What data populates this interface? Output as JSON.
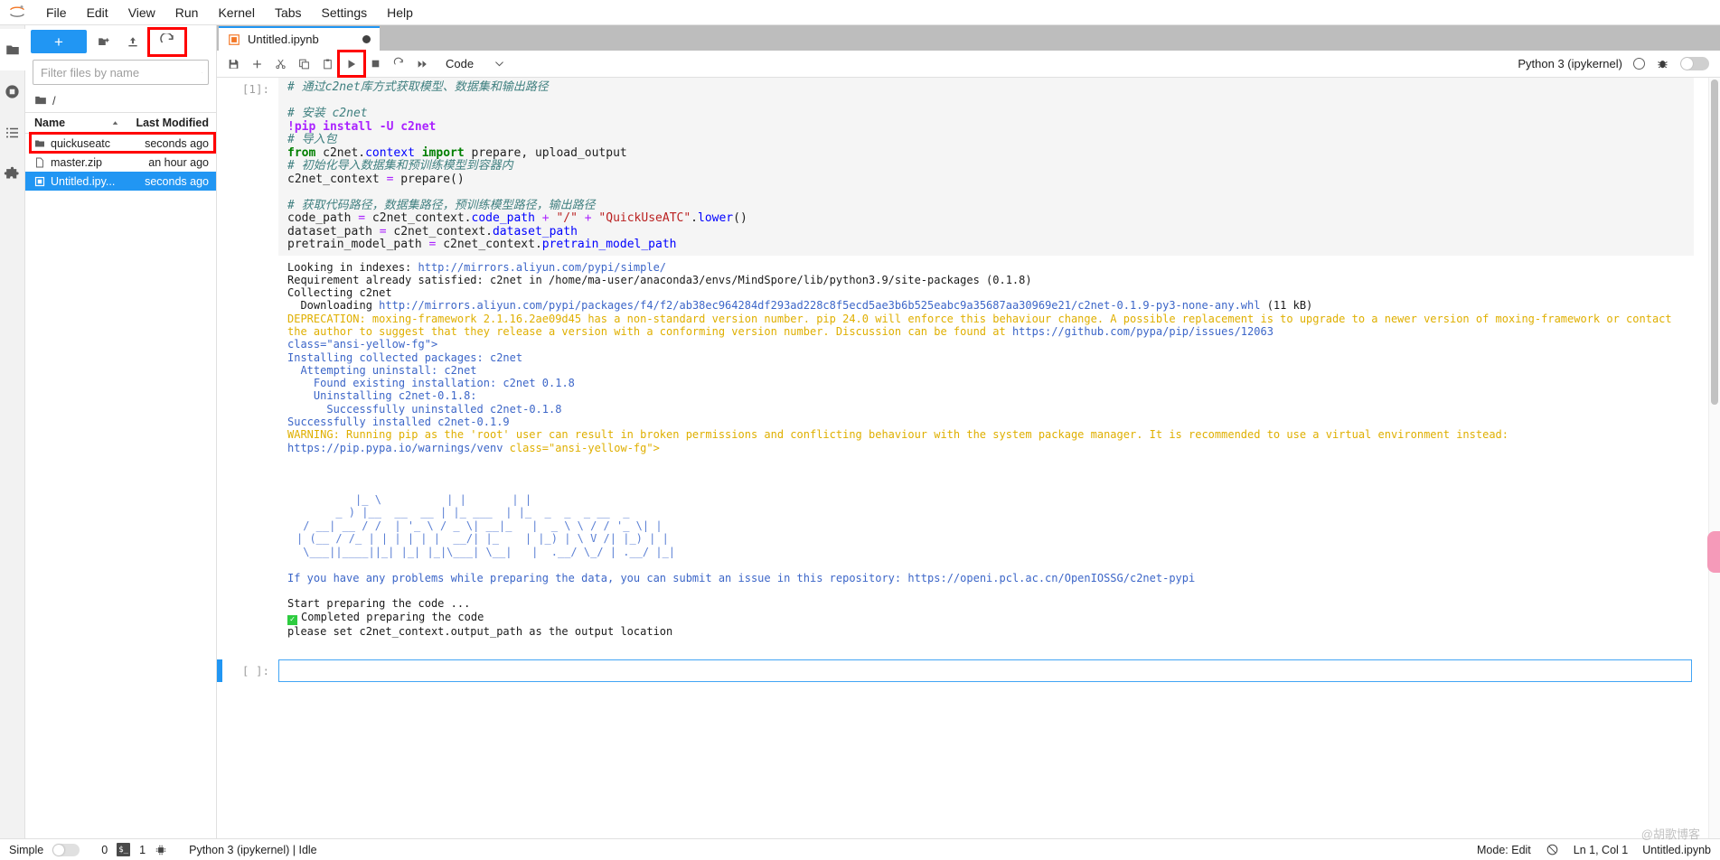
{
  "app": {
    "logo_icon": "jupyter-logo",
    "menus": [
      "File",
      "Edit",
      "View",
      "Run",
      "Kernel",
      "Tabs",
      "Settings",
      "Help"
    ]
  },
  "rail": {
    "items": [
      {
        "name": "file-browser",
        "icon": "folder-icon"
      },
      {
        "name": "running-terminals",
        "icon": "stop-circle-icon"
      },
      {
        "name": "table-of-contents",
        "icon": "list-icon"
      },
      {
        "name": "extension-manager",
        "icon": "puzzle-icon"
      }
    ]
  },
  "filebrowser": {
    "new_label": "+",
    "new_folder_icon": "new-folder-icon",
    "upload_icon": "upload-icon",
    "refresh_icon": "refresh-icon",
    "filter_placeholder": "Filter files by name",
    "search_icon": "search-icon",
    "breadcrumb_icon": "folder-icon",
    "breadcrumb": "/",
    "columns": {
      "name": "Name",
      "modified": "Last Modified"
    },
    "sort_icon": "sort-asc-icon",
    "rows": [
      {
        "name": "quickuseatc",
        "modified": "seconds ago",
        "type": "folder",
        "selected": false,
        "highlighted": true
      },
      {
        "name": "master.zip",
        "modified": "an hour ago",
        "type": "file",
        "selected": false,
        "highlighted": false
      },
      {
        "name": "Untitled.ipy...",
        "modified": "seconds ago",
        "type": "notebook",
        "selected": true,
        "highlighted": false
      }
    ]
  },
  "tabs": [
    {
      "label": "Untitled.ipynb",
      "icon": "notebook-icon",
      "dirty": true,
      "active": true
    }
  ],
  "notebook_toolbar": {
    "buttons": [
      {
        "name": "save-button",
        "icon": "save-icon"
      },
      {
        "name": "insert-cell-button",
        "icon": "plus-icon"
      },
      {
        "name": "cut-cell-button",
        "icon": "scissors-icon"
      },
      {
        "name": "copy-cell-button",
        "icon": "copy-icon"
      },
      {
        "name": "paste-cell-button",
        "icon": "paste-icon"
      },
      {
        "name": "run-cell-button",
        "icon": "play-icon",
        "highlighted": true
      },
      {
        "name": "interrupt-kernel-button",
        "icon": "stop-square-icon"
      },
      {
        "name": "restart-kernel-button",
        "icon": "restart-icon"
      },
      {
        "name": "restart-run-all-button",
        "icon": "fast-forward-icon"
      }
    ],
    "cell_type": "Code",
    "cell_type_chevron": "chevron-down-icon",
    "kernel_name": "Python 3 (ipykernel)",
    "kernel_status_icon": "kernel-idle-circle-icon",
    "debugger_icon": "bug-icon",
    "debugger_toggle": "off"
  },
  "cells": [
    {
      "prompt": "[1]:",
      "source_lines": [
        [
          {
            "t": "# 通过c2net库方式获取模型、数据集和输出路径",
            "c": "c-comment"
          }
        ],
        [
          {
            "t": "",
            "c": "c-plain"
          }
        ],
        [
          {
            "t": "# 安装 c2net",
            "c": "c-comment"
          }
        ],
        [
          {
            "t": "!pip install -U c2net",
            "c": "c-magic"
          }
        ],
        [
          {
            "t": "# 导入包",
            "c": "c-comment"
          }
        ],
        [
          {
            "t": "from",
            "c": "c-kw"
          },
          {
            "t": " c2net.",
            "c": "c-plain"
          },
          {
            "t": "context",
            "c": "c-attr"
          },
          {
            "t": " ",
            "c": "c-plain"
          },
          {
            "t": "import",
            "c": "c-kw"
          },
          {
            "t": " prepare, upload_output",
            "c": "c-plain"
          }
        ],
        [
          {
            "t": "# 初始化导入数据集和预训练模型到容器内",
            "c": "c-comment"
          }
        ],
        [
          {
            "t": "c2net_context ",
            "c": "c-plain"
          },
          {
            "t": "=",
            "c": "c-op"
          },
          {
            "t": " prepare()",
            "c": "c-plain"
          }
        ],
        [
          {
            "t": "",
            "c": "c-plain"
          }
        ],
        [
          {
            "t": "# 获取代码路径，数据集路径，预训练模型路径，输出路径",
            "c": "c-comment"
          }
        ],
        [
          {
            "t": "code_path ",
            "c": "c-plain"
          },
          {
            "t": "=",
            "c": "c-op"
          },
          {
            "t": " c2net_context.",
            "c": "c-plain"
          },
          {
            "t": "code_path",
            "c": "c-attr"
          },
          {
            "t": " ",
            "c": "c-plain"
          },
          {
            "t": "+",
            "c": "c-op"
          },
          {
            "t": " ",
            "c": "c-plain"
          },
          {
            "t": "\"/\"",
            "c": "c-str"
          },
          {
            "t": " ",
            "c": "c-plain"
          },
          {
            "t": "+",
            "c": "c-op"
          },
          {
            "t": " ",
            "c": "c-plain"
          },
          {
            "t": "\"QuickUseATC\"",
            "c": "c-str"
          },
          {
            "t": ".",
            "c": "c-plain"
          },
          {
            "t": "lower",
            "c": "c-attr"
          },
          {
            "t": "()",
            "c": "c-plain"
          }
        ],
        [
          {
            "t": "dataset_path ",
            "c": "c-plain"
          },
          {
            "t": "=",
            "c": "c-op"
          },
          {
            "t": " c2net_context.",
            "c": "c-plain"
          },
          {
            "t": "dataset_path",
            "c": "c-attr"
          }
        ],
        [
          {
            "t": "pretrain_model_path ",
            "c": "c-plain"
          },
          {
            "t": "=",
            "c": "c-op"
          },
          {
            "t": " c2net_context.",
            "c": "c-plain"
          },
          {
            "t": "pretrain_model_path",
            "c": "c-attr"
          }
        ]
      ],
      "output_lines": [
        [
          {
            "t": "Looking in indexes: ",
            "c": "o-plain"
          },
          {
            "t": "http://mirrors.aliyun.com/pypi/simple/",
            "c": "o-link"
          }
        ],
        [
          {
            "t": "Requirement already satisfied: c2net in /home/ma-user/anaconda3/envs/MindSpore/lib/python3.9/site-packages (0.1.8)",
            "c": "o-plain"
          }
        ],
        [
          {
            "t": "Collecting c2net",
            "c": "o-plain"
          }
        ],
        [
          {
            "t": "  Downloading ",
            "c": "o-plain"
          },
          {
            "t": "http://mirrors.aliyun.com/pypi/packages/f4/f2/ab38ec964284df293ad228c8f5ecd5ae3b6b525eabc9a35687aa30969e21/c2net-0.1.9-py3-none-any.whl",
            "c": "o-link"
          },
          {
            "t": " (11 kB)",
            "c": "o-plain"
          }
        ],
        [
          {
            "t": "DEPRECATION: moxing-framework 2.1.16.2ae09d45 has a non-standard version number. pip 24.0 will enforce this behaviour change. A possible replacement is to upgrade to a newer version of moxing-framework or contact the author to suggest that they release a version with a conforming version number. Discussion can be found at ",
            "c": "o-yellow"
          },
          {
            "t": "https://github.com/pypa/pip/issues/12063",
            "c": "o-link"
          }
        ],
        [
          {
            "t": "class=\"ansi-yellow-fg\">",
            "c": "o-link"
          }
        ],
        [
          {
            "t": "Installing collected packages: c2net",
            "c": "o-blue"
          }
        ],
        [
          {
            "t": "  Attempting uninstall: c2net",
            "c": "o-blue"
          }
        ],
        [
          {
            "t": "    Found existing installation: c2net 0.1.8",
            "c": "o-blue"
          }
        ],
        [
          {
            "t": "    Uninstalling c2net-0.1.8:",
            "c": "o-blue"
          }
        ],
        [
          {
            "t": "      Successfully uninstalled c2net-0.1.8",
            "c": "o-blue"
          }
        ],
        [
          {
            "t": "Successfully installed c2net-0.1.9",
            "c": "o-blue"
          }
        ],
        [
          {
            "t": "WARNING: Running pip as the 'root' user can result in broken permissions and conflicting behaviour with the system package manager. It is recommended to use a virtual environment instead: ",
            "c": "o-yellow"
          },
          {
            "t": "https://pip.pypa.io/warnings/venv",
            "c": "o-link"
          },
          {
            "t": " class=\"ansi-yellow-fg\">",
            "c": "o-yellow"
          }
        ],
        [
          {
            "t": "",
            "c": "o-plain"
          }
        ],
        [
          {
            "t": "",
            "c": "o-plain"
          }
        ],
        [
          {
            "t": "",
            "c": "o-plain"
          }
        ]
      ],
      "ascii_art": [
        "         |_ \\          | |       | |",
        "      _ ) |__  __  __ | |_ ___  | |_  _  _  _ __  _",
        " / __| __ / /  | '_ \\ / _ \\| __|_   |  _ \\ \\ / / '_ \\| |",
        "| (__ / /_ | | | | | |  __/| |_    | |_) | \\ V /| |_) | |",
        " \\___||____||_| |_| |_|\\___| \\__|   |  .__/ \\_/ | .__/ |_|"
      ],
      "output_tail": [
        [
          {
            "t": "",
            "c": "o-plain"
          }
        ],
        [
          {
            "t": "If you have any problems while preparing the data, you can submit an issue in this repository: ",
            "c": "o-blue"
          },
          {
            "t": "https://openi.pcl.ac.cn/OpenIOSSG/c2net-pypi",
            "c": "o-link"
          }
        ],
        [
          {
            "t": "",
            "c": "o-plain"
          }
        ],
        [
          {
            "t": "Start preparing the code ...",
            "c": "o-plain"
          }
        ],
        [
          {
            "t": "CHECK Completed preparing the code",
            "c": "o-plain"
          }
        ],
        [
          {
            "t": "please set c2net_context.output_path as the output location",
            "c": "o-plain"
          }
        ]
      ],
      "check_icon": "check-mark-icon"
    },
    {
      "prompt": "[ ]:",
      "empty": true,
      "selected": true
    }
  ],
  "statusbar": {
    "simple_label": "Simple",
    "simple_toggle": "off",
    "kernel_count": "0",
    "terminal_icon": "terminal-icon",
    "terminal_count": "1",
    "gear_icon": "kernel-gear-icon",
    "kernel_info": "Python 3 (ipykernel) | Idle",
    "mode": "Mode: Edit",
    "shield_icon": "shield-off-icon",
    "position": "Ln 1, Col 1",
    "filename": "Untitled.ipynb"
  },
  "watermark": "@胡歌博客",
  "colors": {
    "accent": "#2196f3",
    "highlight_red": "#ff0000",
    "toolbar_gray": "#bdbdbd",
    "cell_bg": "#f5f5f5",
    "output_blue": "#3c66c8",
    "output_yellow": "#dfaf00"
  }
}
